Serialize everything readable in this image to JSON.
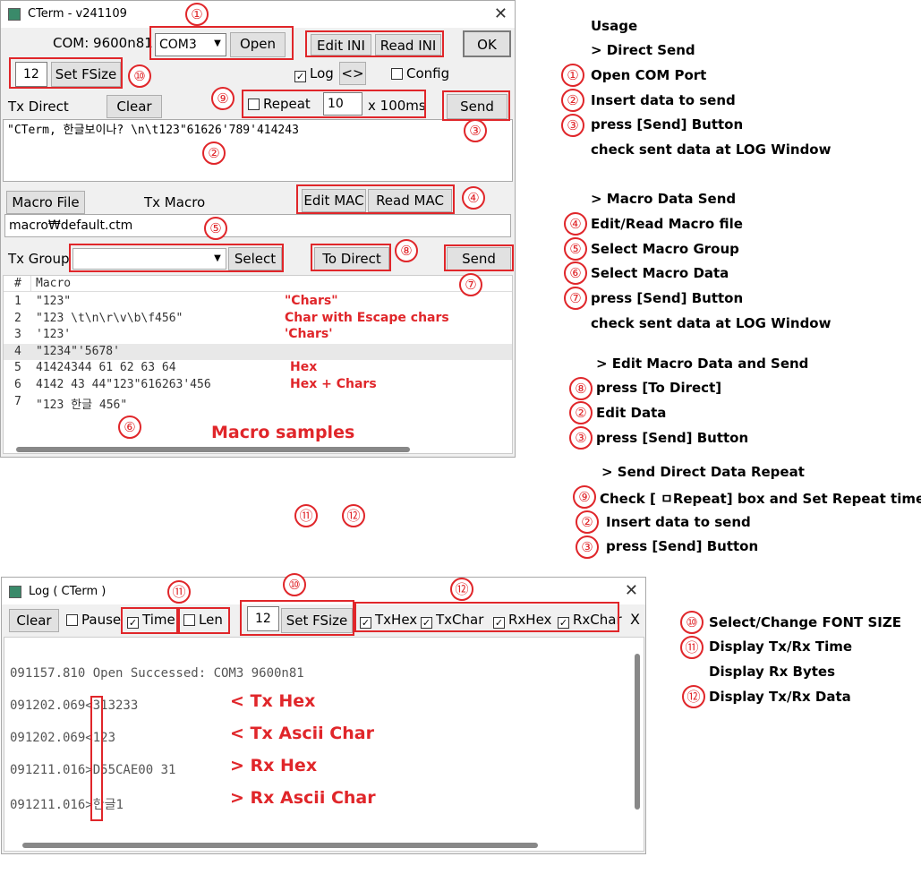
{
  "main": {
    "title": "CTerm - v241109",
    "com_label": "COM: 9600n81",
    "com_port": "COM3",
    "open": "Open",
    "edit_ini": "Edit INI",
    "read_ini": "Read INI",
    "ok": "OK",
    "font_size": "12",
    "set_fsize": "Set FSize",
    "log": "Log",
    "toggle": "<>",
    "config": "Config",
    "tx_direct": "Tx Direct",
    "clear": "Clear",
    "repeat": "Repeat",
    "repeat_value": "10",
    "repeat_unit": "x 100ms",
    "send": "Send",
    "tx_text": "\"CTerm, 한글보이나? \\n\\t123\"61626'789'414243",
    "macro_file_btn": "Macro File",
    "tx_macro": "Tx Macro",
    "edit_mac": "Edit MAC",
    "read_mac": "Read MAC",
    "macro_path": "macro₩default.ctm",
    "tx_group": "Tx Group",
    "select": "Select",
    "to_direct": "To Direct",
    "send2": "Send",
    "col_num": "#",
    "col_macro": "Macro",
    "rows": [
      {
        "n": "1",
        "v": "\"123\"",
        "note": "\"Chars\""
      },
      {
        "n": "2",
        "v": "\"123 \\t\\n\\r\\v\\b\\f456\"",
        "note": "Char with Escape chars"
      },
      {
        "n": "3",
        "v": "'123'",
        "note": "'Chars'"
      },
      {
        "n": "4",
        "v": "\"1234\"'5678'",
        "note": ""
      },
      {
        "n": "5",
        "v": "41424344 61 62 63 64",
        "note": "Hex"
      },
      {
        "n": "6",
        "v": "4142 43 44\"123\"616263'456",
        "note": "Hex + Chars"
      },
      {
        "n": "7",
        "v": "\"123 한글 456\"",
        "note": ""
      }
    ],
    "samples": "Macro samples"
  },
  "log": {
    "title": "Log ( CTerm )",
    "clear": "Clear",
    "pause": "Pause",
    "time": "Time",
    "len": "Len",
    "font_size": "12",
    "set_fsize": "Set FSize",
    "txhex": "TxHex",
    "txchar": "TxChar",
    "rxhex": "RxHex",
    "rxchar": "RxChar",
    "x": "X",
    "lines": [
      {
        "text": "091157.810 Open Successed: COM3 9600n81",
        "note": ""
      },
      {
        "text": "091202.069<313233",
        "note": "< Tx Hex"
      },
      {
        "text": "091202.069<123",
        "note": "< Tx Ascii Char"
      },
      {
        "text": "091211.016>D55CAE00 31",
        "note": "> Rx Hex"
      },
      {
        "text": "091211.016>한글1",
        "note": "> Rx Ascii Char"
      }
    ]
  },
  "numbers": {
    "n1": "①",
    "n2": "②",
    "n3": "③",
    "n4": "④",
    "n5": "⑤",
    "n6": "⑥",
    "n7": "⑦",
    "n8": "⑧",
    "n9": "⑨",
    "n10": "⑩",
    "n11": "⑪",
    "n12": "⑫"
  },
  "usage": {
    "title": "Usage",
    "direct_send": "> Direct Send",
    "open_com": "Open COM Port",
    "insert": "Insert data to send",
    "press_send": "press [Send] Button",
    "check_log": "check sent data at LOG Window",
    "macro_send": "> Macro Data Send",
    "edit_macro": "Edit/Read Macro file",
    "select_group": "Select Macro Group",
    "select_data": "Select Macro Data",
    "press_send2": "press [Send] Button",
    "check_log2": "check sent data at LOG Window",
    "edit_send": "> Edit Macro Data and Send",
    "press_to_direct": "press [To Direct]",
    "edit_data": "Edit Data",
    "press_send3": "press [Send] Button",
    "repeat_title": "> Send Direct Data Repeat",
    "check_repeat": "Check [ ㅁRepeat] box and Set Repeat time",
    "insert2": "Insert data to send",
    "press_send4": "press [Send] Button",
    "font": "Select/Change FONT SIZE",
    "time": "Display Tx/Rx Time",
    "bytes": "Display Rx Bytes",
    "data": "Display Tx/Rx Data"
  },
  "colors": {
    "accent": "#e0262a"
  }
}
